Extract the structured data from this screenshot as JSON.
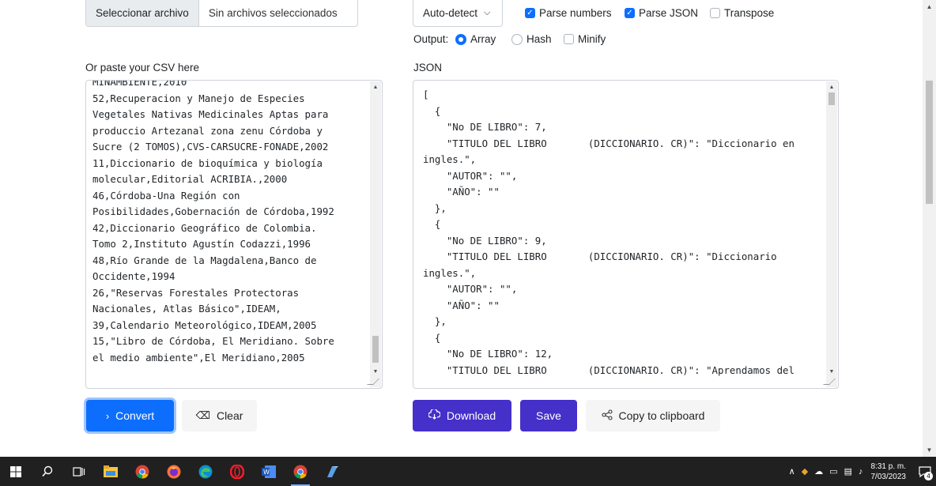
{
  "file_input": {
    "button_label": "Seleccionar archivo",
    "status_text": "Sin archivos seleccionados"
  },
  "options": {
    "separator_select": "Auto-detect",
    "parse_numbers": {
      "label": "Parse numbers",
      "checked": true
    },
    "parse_json": {
      "label": "Parse JSON",
      "checked": true
    },
    "transpose": {
      "label": "Transpose",
      "checked": false
    },
    "output_label": "Output:",
    "output_array": {
      "label": "Array",
      "selected": true
    },
    "output_hash": {
      "label": "Hash",
      "selected": false
    },
    "minify": {
      "label": "Minify",
      "checked": false
    }
  },
  "csv_panel": {
    "label": "Or paste your CSV here",
    "content": "MINAMBIENTE,2010\n52,Recuperacion y Manejo de Especies\nVegetales Nativas Medicinales Aptas para\nproduccio Artezanal zona zenu Córdoba y\nSucre (2 TOMOS),CVS-CARSUCRE-FONADE,2002\n11,Diccionario de bioquímica y biología\nmolecular,Editorial ACRIBIA.,2000\n46,Córdoba-Una Región con\nPosibilidades,Gobernación de Córdoba,1992\n42,Diccionario Geográfico de Colombia.\nTomo 2,Instituto Agustín Codazzi,1996\n48,Río Grande de la Magdalena,Banco de\nOccidente,1994\n26,\"Reservas Forestales Protectoras\nNacionales, Atlas Básico\",IDEAM,\n39,Calendario Meteorológico,IDEAM,2005\n15,\"Libro de Córdoba, El Meridiano. Sobre\nel medio ambiente\",El Meridiano,2005"
  },
  "json_panel": {
    "label": "JSON",
    "content": "[\n  {\n    \"No DE LIBRO\": 7,\n    \"TITULO DEL LIBRO       (DICCIONARIO. CR)\": \"Diccionario en\ningles.\",\n    \"AUTOR\": \"\",\n    \"AÑO\": \"\"\n  },\n  {\n    \"No DE LIBRO\": 9,\n    \"TITULO DEL LIBRO       (DICCIONARIO. CR)\": \"Diccionario\ningles.\",\n    \"AUTOR\": \"\",\n    \"AÑO\": \"\"\n  },\n  {\n    \"No DE LIBRO\": 12,\n    \"TITULO DEL LIBRO       (DICCIONARIO. CR)\": \"Aprendamos del"
  },
  "buttons": {
    "convert": "Convert",
    "clear": "Clear",
    "download": "Download",
    "save": "Save",
    "copy": "Copy to clipboard"
  },
  "taskbar": {
    "time": "8:31 p. m.",
    "date": "7/03/2023",
    "notification_count": "4"
  },
  "colors": {
    "primary": "#0d6efd",
    "accent": "#4530c9",
    "taskbar": "#202020"
  }
}
